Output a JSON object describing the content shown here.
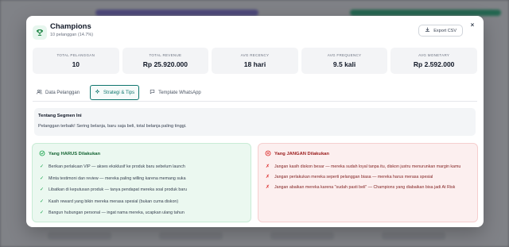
{
  "header": {
    "title": "Champions",
    "subtitle": "10 pelanggan (14.7%)",
    "export_label": "Export CSV",
    "close_label": "×"
  },
  "stats": [
    {
      "label": "TOTAL PELANGGAN",
      "value": "10"
    },
    {
      "label": "TOTAL REVENUE",
      "value": "Rp 25.920.000"
    },
    {
      "label": "AVG RECENCY",
      "value": "18 hari"
    },
    {
      "label": "AVG FREQUENCY",
      "value": "9.5 kali"
    },
    {
      "label": "AVG MONETARY",
      "value": "Rp 2.592.000"
    }
  ],
  "tabs": [
    {
      "label": "Data Pelanggan",
      "icon": "users-icon",
      "active": false
    },
    {
      "label": "Strategi & Tips",
      "icon": "sparkle-icon",
      "active": true
    },
    {
      "label": "Template WhatsApp",
      "icon": "chat-icon",
      "active": false
    }
  ],
  "about": {
    "title": "Tentang Segmen Ini",
    "text": "Pelanggan terbaik! Sering belanja, baru saja beli, total belanja paling tinggi."
  },
  "do_panel": {
    "title": "Yang HARUS Dilakukan",
    "items": [
      "Berikan perlakuan VIP — akses eksklusif ke produk baru sebelum launch",
      "Minta testimoni dan review — mereka paling willing karena memang suka",
      "Libatkan di keputusan produk — tanya pendapat mereka soal produk baru",
      "Kasih reward yang bikin mereka merasa spesial (bukan cuma diskon)",
      "Bangun hubungan personal — ingat nama mereka, ucapkan ulang tahun"
    ]
  },
  "dont_panel": {
    "title": "Yang JANGAN Dilakukan",
    "items": [
      "Jangan kasih diskon besar — mereka sudah loyal tanpa itu, diskon justru menurunkan margin kamu",
      "Jangan perlakukan mereka seperti pelanggan biasa — mereka harus merasa spesial",
      "Jangan abaikan mereka karena \"sudah pasti beli\" — Champions yang diabaikan bisa jadi At Risk"
    ]
  },
  "colors": {
    "accent": "#0f766e",
    "do_bg": "#ebf8f0",
    "dont_bg": "#fcefef"
  }
}
